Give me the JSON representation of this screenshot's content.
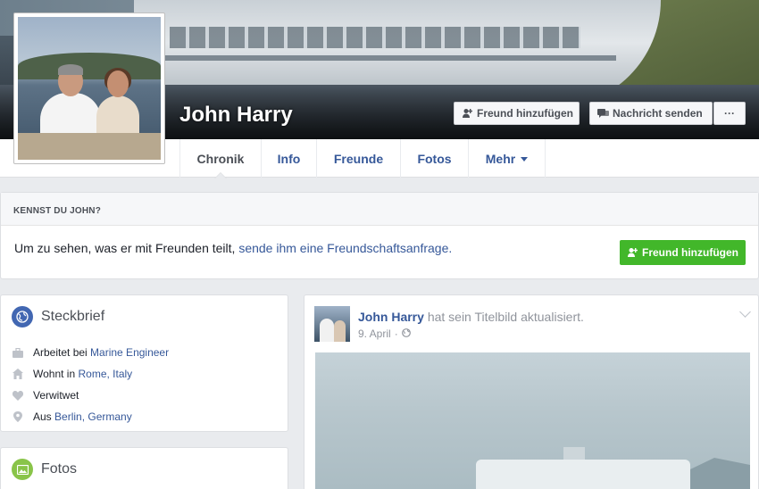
{
  "profile": {
    "name": "John Harry"
  },
  "cover_actions": {
    "add_friend": "Freund hinzufügen",
    "send_message": "Nachricht senden",
    "more": "···"
  },
  "tabs": [
    {
      "label": "Chronik",
      "active": true
    },
    {
      "label": "Info"
    },
    {
      "label": "Freunde"
    },
    {
      "label": "Fotos"
    },
    {
      "label": "Mehr"
    }
  ],
  "know_box": {
    "heading": "KENNST DU JOHN?",
    "message_prefix": "Um zu sehen, was er mit Freunden teilt, ",
    "message_link": "sende ihm eine Freundschaftsanfrage.",
    "button": "Freund hinzufügen"
  },
  "intro": {
    "title": "Steckbrief",
    "items": [
      {
        "icon": "briefcase-icon",
        "prefix": "Arbeitet bei",
        "link": "Marine Engineer"
      },
      {
        "icon": "home-icon",
        "prefix": "Wohnt in",
        "link": "Rome, Italy"
      },
      {
        "icon": "heart-icon",
        "prefix": "Verwitwet",
        "link": ""
      },
      {
        "icon": "location-pin-icon",
        "prefix": "Aus",
        "link": "Berlin, Germany"
      }
    ]
  },
  "photos": {
    "title": "Fotos"
  },
  "post": {
    "author": "John Harry",
    "action": "hat sein Titelbild aktualisiert.",
    "date": "9. April",
    "separator": "·"
  },
  "colors": {
    "link": "#365899",
    "green_button": "#42b72a",
    "intro_icon": "#4267b2",
    "photos_icon": "#89c449"
  }
}
